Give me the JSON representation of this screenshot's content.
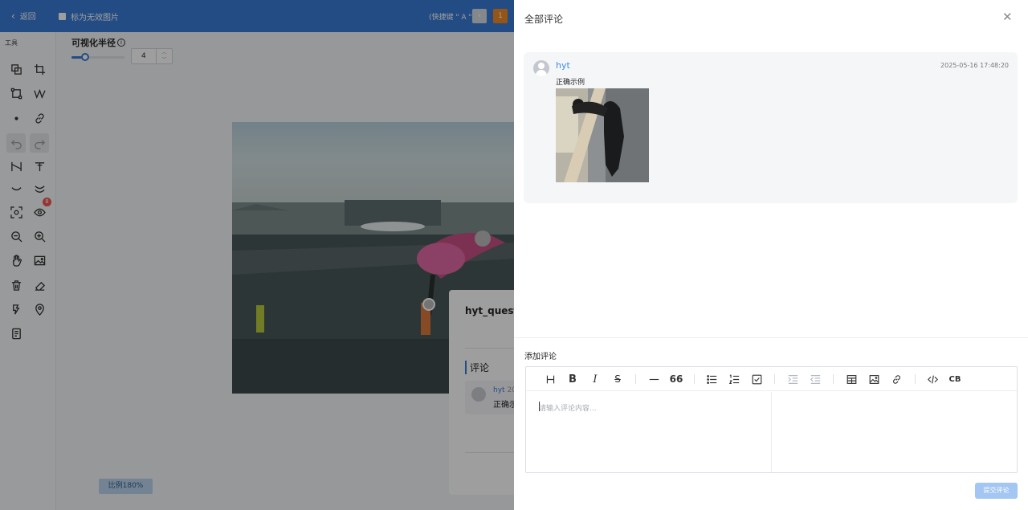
{
  "topbar": {
    "back_label": "返回",
    "invalid_label": "标为无效图片",
    "shortcut_hint": "(快捷键 \" A \")",
    "page_number": "1"
  },
  "tools": {
    "label": "工具",
    "eye_badge": "8"
  },
  "radius": {
    "label": "可视化半径",
    "value": "4",
    "slider_fraction": 0.25
  },
  "zoom_label": "比例180%",
  "question_card": {
    "title": "hyt_question",
    "section": "评论",
    "user": "hyt",
    "date_partial": "20",
    "text": "正确示"
  },
  "drawer": {
    "title": "全部评论",
    "comments": [
      {
        "user": "hyt",
        "time": "2025-05-16 17:48:20",
        "text": "正确示例"
      }
    ],
    "add_title": "添加评论",
    "placeholder": "请输入评论内容...",
    "submit_label": "提交评论"
  },
  "colors": {
    "topbar": "#3a7bd5",
    "accent": "#3a8ee6",
    "badge": "#f0544f",
    "page_active": "#f08a24",
    "submit_disabled": "#a3c6f2"
  }
}
